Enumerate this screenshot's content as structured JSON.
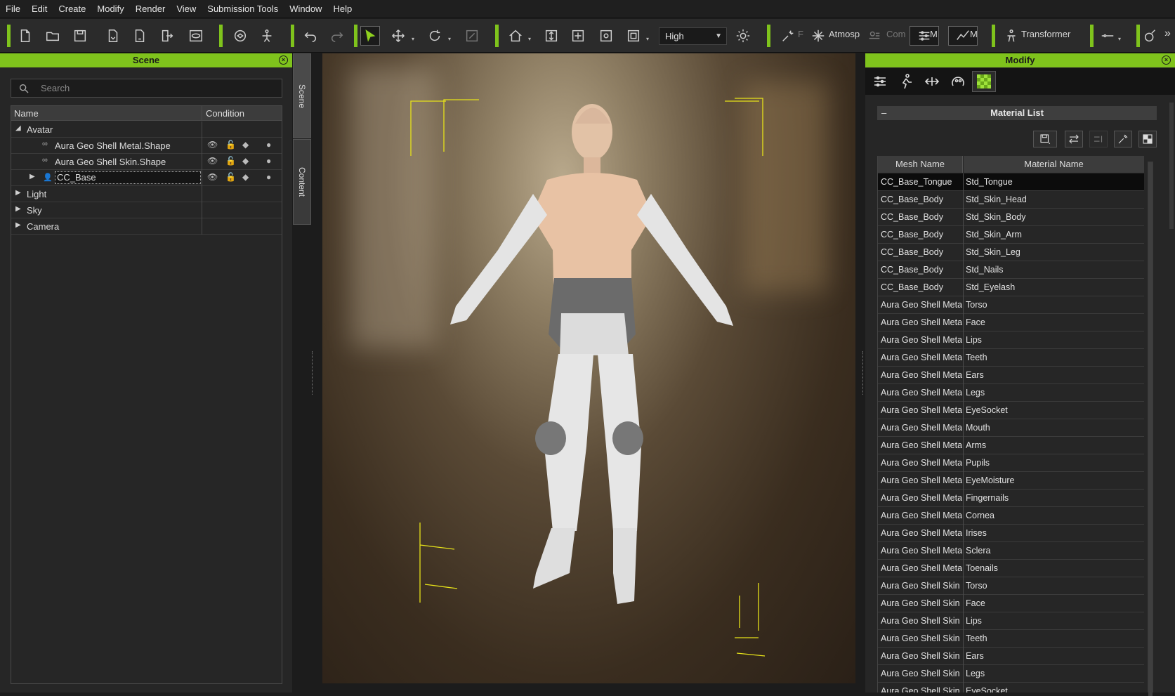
{
  "menu": [
    "File",
    "Edit",
    "Create",
    "Modify",
    "Render",
    "View",
    "Submission Tools",
    "Window",
    "Help"
  ],
  "toolbar": {
    "quality": "High",
    "label_f": "F",
    "label_atmosphere": "Atmosp",
    "label_com": "Com",
    "label_m1": "M",
    "label_m2": "M",
    "label_transformer": "Transformer",
    "accent": "#7fc31c"
  },
  "scene": {
    "title": "Scene",
    "search_placeholder": "Search",
    "columns": {
      "name": "Name",
      "condition": "Condition"
    },
    "items": [
      {
        "label": "Avatar"
      },
      {
        "label": "Aura Geo Shell Metal.Shape"
      },
      {
        "label": "Aura Geo Shell Skin.Shape"
      },
      {
        "label": "CC_Base"
      },
      {
        "label": "Light"
      },
      {
        "label": "Sky"
      },
      {
        "label": "Camera"
      }
    ]
  },
  "side_tabs": {
    "scene": "Scene",
    "content": "Content"
  },
  "modify": {
    "title": "Modify",
    "material_list": {
      "title": "Material List",
      "columns": {
        "mesh": "Mesh Name",
        "material": "Material Name"
      },
      "rows": [
        {
          "mesh": "CC_Base_Tongue",
          "material": "Std_Tongue"
        },
        {
          "mesh": "CC_Base_Body",
          "material": "Std_Skin_Head"
        },
        {
          "mesh": "CC_Base_Body",
          "material": "Std_Skin_Body"
        },
        {
          "mesh": "CC_Base_Body",
          "material": "Std_Skin_Arm"
        },
        {
          "mesh": "CC_Base_Body",
          "material": "Std_Skin_Leg"
        },
        {
          "mesh": "CC_Base_Body",
          "material": "Std_Nails"
        },
        {
          "mesh": "CC_Base_Body",
          "material": "Std_Eyelash"
        },
        {
          "mesh": "Aura Geo Shell Metal",
          "material": "Torso"
        },
        {
          "mesh": "Aura Geo Shell Metal",
          "material": "Face"
        },
        {
          "mesh": "Aura Geo Shell Metal",
          "material": "Lips"
        },
        {
          "mesh": "Aura Geo Shell Metal",
          "material": "Teeth"
        },
        {
          "mesh": "Aura Geo Shell Metal",
          "material": "Ears"
        },
        {
          "mesh": "Aura Geo Shell Metal",
          "material": "Legs"
        },
        {
          "mesh": "Aura Geo Shell Metal",
          "material": "EyeSocket"
        },
        {
          "mesh": "Aura Geo Shell Metal",
          "material": "Mouth"
        },
        {
          "mesh": "Aura Geo Shell Metal",
          "material": "Arms"
        },
        {
          "mesh": "Aura Geo Shell Metal",
          "material": "Pupils"
        },
        {
          "mesh": "Aura Geo Shell Metal",
          "material": "EyeMoisture"
        },
        {
          "mesh": "Aura Geo Shell Metal",
          "material": "Fingernails"
        },
        {
          "mesh": "Aura Geo Shell Metal",
          "material": "Cornea"
        },
        {
          "mesh": "Aura Geo Shell Metal",
          "material": "Irises"
        },
        {
          "mesh": "Aura Geo Shell Metal",
          "material": "Sclera"
        },
        {
          "mesh": "Aura Geo Shell Metal",
          "material": "Toenails"
        },
        {
          "mesh": "Aura Geo Shell Skin",
          "material": "Torso"
        },
        {
          "mesh": "Aura Geo Shell Skin",
          "material": "Face"
        },
        {
          "mesh": "Aura Geo Shell Skin",
          "material": "Lips"
        },
        {
          "mesh": "Aura Geo Shell Skin",
          "material": "Teeth"
        },
        {
          "mesh": "Aura Geo Shell Skin",
          "material": "Ears"
        },
        {
          "mesh": "Aura Geo Shell Skin",
          "material": "Legs"
        },
        {
          "mesh": "Aura Geo Shell Skin",
          "material": "EyeSocket"
        }
      ]
    }
  }
}
